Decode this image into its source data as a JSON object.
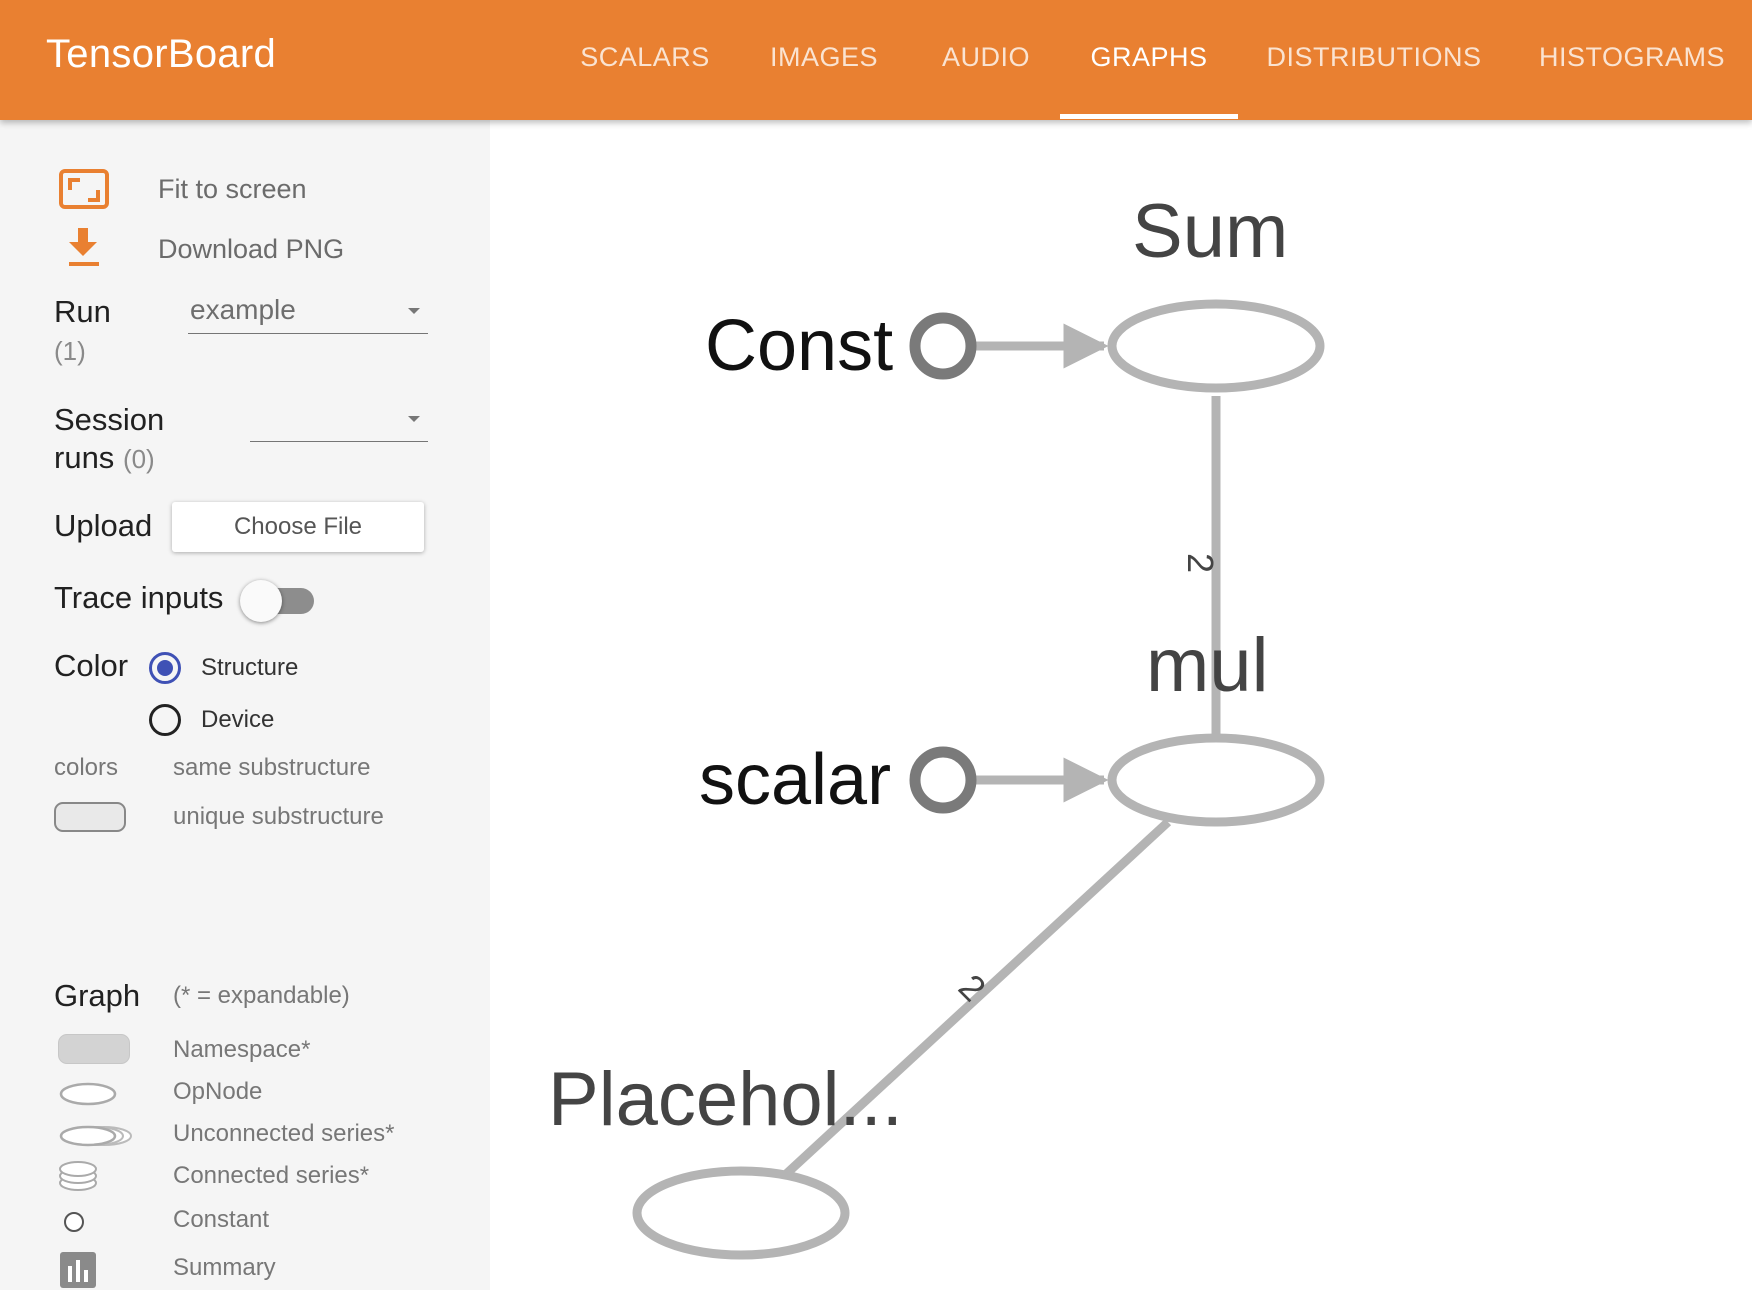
{
  "header": {
    "title": "TensorBoard",
    "tabs": [
      {
        "label": "SCALARS",
        "active": false
      },
      {
        "label": "IMAGES",
        "active": false
      },
      {
        "label": "AUDIO",
        "active": false
      },
      {
        "label": "GRAPHS",
        "active": true
      },
      {
        "label": "DISTRIBUTIONS",
        "active": false
      },
      {
        "label": "HISTOGRAMS",
        "active": false
      }
    ],
    "color": "#e98031"
  },
  "sidebar": {
    "fit_to_screen": "Fit to screen",
    "download_png": "Download PNG",
    "run": {
      "label": "Run",
      "count": "(1)",
      "value": "example"
    },
    "session_runs": {
      "label_line1": "Session",
      "label_line2": "runs",
      "count": "(0)",
      "value": ""
    },
    "upload": {
      "label": "Upload",
      "button": "Choose File"
    },
    "trace_inputs": {
      "label": "Trace inputs",
      "enabled": false
    },
    "color": {
      "label": "Color",
      "options": [
        {
          "label": "Structure",
          "selected": true
        },
        {
          "label": "Device",
          "selected": false
        }
      ],
      "colors_label": "colors",
      "same_substructure": "same substructure",
      "unique_substructure": "unique substructure"
    },
    "graph_legend": {
      "label": "Graph",
      "hint": "(* = expandable)",
      "items": [
        "Namespace*",
        "OpNode",
        "Unconnected series*",
        "Connected series*",
        "Constant",
        "Summary"
      ]
    }
  },
  "graph": {
    "nodes": [
      {
        "name": "Sum",
        "kind": "opnode"
      },
      {
        "name": "mul",
        "kind": "opnode"
      },
      {
        "name": "Placehol...",
        "kind": "opnode"
      },
      {
        "name": "Const",
        "kind": "constant"
      },
      {
        "name": "scalar",
        "kind": "constant"
      }
    ],
    "edges": [
      {
        "from": "mul",
        "to": "Sum",
        "label": "2"
      },
      {
        "from": "Placehol...",
        "to": "mul",
        "label": "2"
      },
      {
        "from": "Const",
        "to": "Sum",
        "label": ""
      },
      {
        "from": "scalar",
        "to": "mul",
        "label": ""
      }
    ],
    "edge_color": "#b4b4b4",
    "constant_color": "#7a7a7a"
  }
}
